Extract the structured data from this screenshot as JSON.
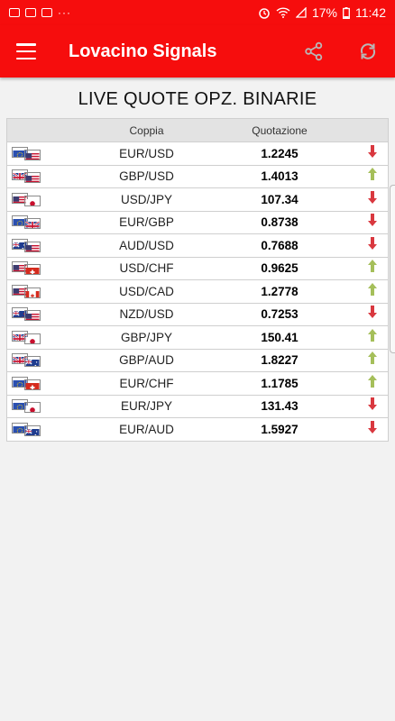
{
  "status_bar": {
    "battery": "17%",
    "time": "11:42",
    "more": "···"
  },
  "app_bar": {
    "title": "Lovacino Signals",
    "menu_icon": "menu-icon",
    "share_icon": "share-icon",
    "refresh_icon": "refresh-icon"
  },
  "heading": "LIVE QUOTE OPZ. BINARIE",
  "table": {
    "col_pair": "Coppia",
    "col_quote": "Quotazione",
    "rows": [
      {
        "pair": "EUR/USD",
        "quote": "1.2245",
        "trend": "down",
        "base": "eu",
        "quotecur": "us"
      },
      {
        "pair": "GBP/USD",
        "quote": "1.4013",
        "trend": "up",
        "base": "gb",
        "quotecur": "us"
      },
      {
        "pair": "USD/JPY",
        "quote": "107.34",
        "trend": "down",
        "base": "us",
        "quotecur": "jp"
      },
      {
        "pair": "EUR/GBP",
        "quote": "0.8738",
        "trend": "down",
        "base": "eu",
        "quotecur": "gb"
      },
      {
        "pair": "AUD/USD",
        "quote": "0.7688",
        "trend": "down",
        "base": "au",
        "quotecur": "us"
      },
      {
        "pair": "USD/CHF",
        "quote": "0.9625",
        "trend": "up",
        "base": "us",
        "quotecur": "ch"
      },
      {
        "pair": "USD/CAD",
        "quote": "1.2778",
        "trend": "up",
        "base": "us",
        "quotecur": "ca"
      },
      {
        "pair": "NZD/USD",
        "quote": "0.7253",
        "trend": "down",
        "base": "nz",
        "quotecur": "us"
      },
      {
        "pair": "GBP/JPY",
        "quote": "150.41",
        "trend": "up",
        "base": "gb",
        "quotecur": "jp"
      },
      {
        "pair": "GBP/AUD",
        "quote": "1.8227",
        "trend": "up",
        "base": "gb",
        "quotecur": "au"
      },
      {
        "pair": "EUR/CHF",
        "quote": "1.1785",
        "trend": "up",
        "base": "eu",
        "quotecur": "ch"
      },
      {
        "pair": "EUR/JPY",
        "quote": "131.43",
        "trend": "down",
        "base": "eu",
        "quotecur": "jp"
      },
      {
        "pair": "EUR/AUD",
        "quote": "1.5927",
        "trend": "down",
        "base": "eu",
        "quotecur": "au"
      }
    ]
  },
  "colors": {
    "brand_red": "#f60d0d",
    "trend_up": "#a5bf5a",
    "trend_down": "#d9383f"
  }
}
